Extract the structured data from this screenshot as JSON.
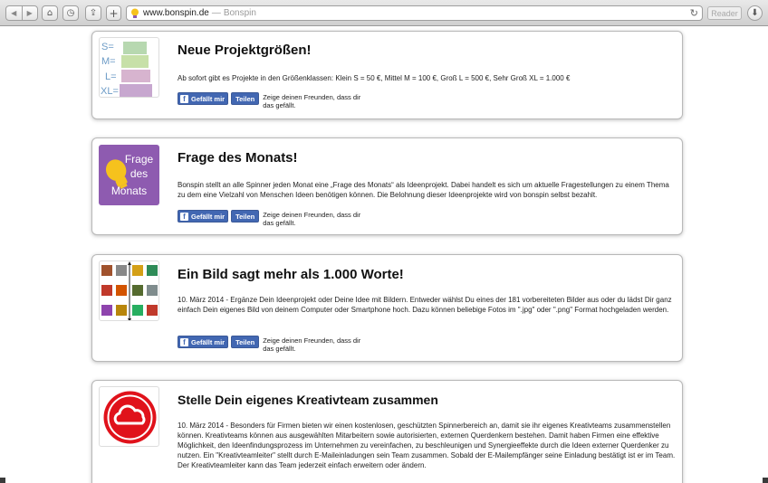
{
  "browser": {
    "url": "www.bonspin.de",
    "page_title": "Bonspin",
    "reader_label": "Reader",
    "reload_icon": "reload-icon",
    "buttons": [
      "back-icon",
      "forward-icon",
      "home-icon",
      "history-icon",
      "share-icon",
      "add-icon"
    ]
  },
  "cards": [
    {
      "title": "Neue Projektgrößen!",
      "thumb_labels": [
        "S=",
        "M=",
        "L=",
        "XL="
      ],
      "description": "Ab sofort gibt es Projekte in den Größenklassen: Klein S = 50 €, Mittel M = 100 €, Groß L = 500 €, Sehr Groß XL = 1.000 €",
      "like_label": "Gefällt mir",
      "share_label": "Teilen",
      "share_note": "Zeige deinen Freunden, dass dir das gefällt."
    },
    {
      "title": "Frage des Monats!",
      "thumb_text": [
        "Frage",
        "des",
        "Monats"
      ],
      "description": "Bonspin stellt an alle Spinner jeden Monat eine „Frage des Monats“ als Ideenprojekt. Dabei handelt es sich um aktuelle Fragestellungen zu einem Thema zu dem eine Vielzahl von Menschen Ideen benötigen können. Die Belohnung dieser Ideenprojekte wird von bonspin selbst bezahlt.",
      "like_label": "Gefällt mir",
      "share_label": "Teilen",
      "share_note": "Zeige deinen Freunden, dass dir das gefällt."
    },
    {
      "title": "Ein Bild sagt mehr als 1.000 Worte!",
      "description": "10. März 2014 - Ergänze Dein Ideenprojekt oder Deine Idee mit Bildern. Entweder wählst Du eines der 181 vorbereiteten Bilder aus oder du lädst Dir ganz einfach Dein eigenes Bild von deinem Computer oder Smartphone hoch. Dazu können beliebige Fotos im \".jpg\" oder \".png\" Format hochgeladen werden.",
      "like_label": "Gefällt mir",
      "share_label": "Teilen",
      "share_note": "Zeige deinen Freunden, dass dir das gefällt."
    },
    {
      "title": "Stelle Dein eigenes Kreativteam zusammen",
      "description": "10. März 2014 - Besonders für Firmen bieten wir einen kostenlosen, geschützten Spinnerbereich an, damit sie ihr eigenes Kreativteams zusammenstellen können. Kreativteams können aus ausgewählten Mitarbeitern sowie autorisierten, externen Querdenkern bestehen. Damit haben Firmen eine effektive Möglichkeit, den Ideenfindungsprozess im Unternehmen zu vereinfachen, zu beschleunigen und Synergieeffekte durch die Ideen externer Querdenker zu nutzen. Ein \"Kreativteamleiter\" stellt durch E-Maileinladungen sein Team zusammen. Sobald der E-Mailempfänger seine Einladung bestätigt ist er im Team. Der Kreativteamleiter kann das Team jederzeit einfach erweitern oder ändern."
    }
  ],
  "colors": {
    "facebook": "#4267b2",
    "purple": "#8e5bb0",
    "red": "#e0121b"
  }
}
